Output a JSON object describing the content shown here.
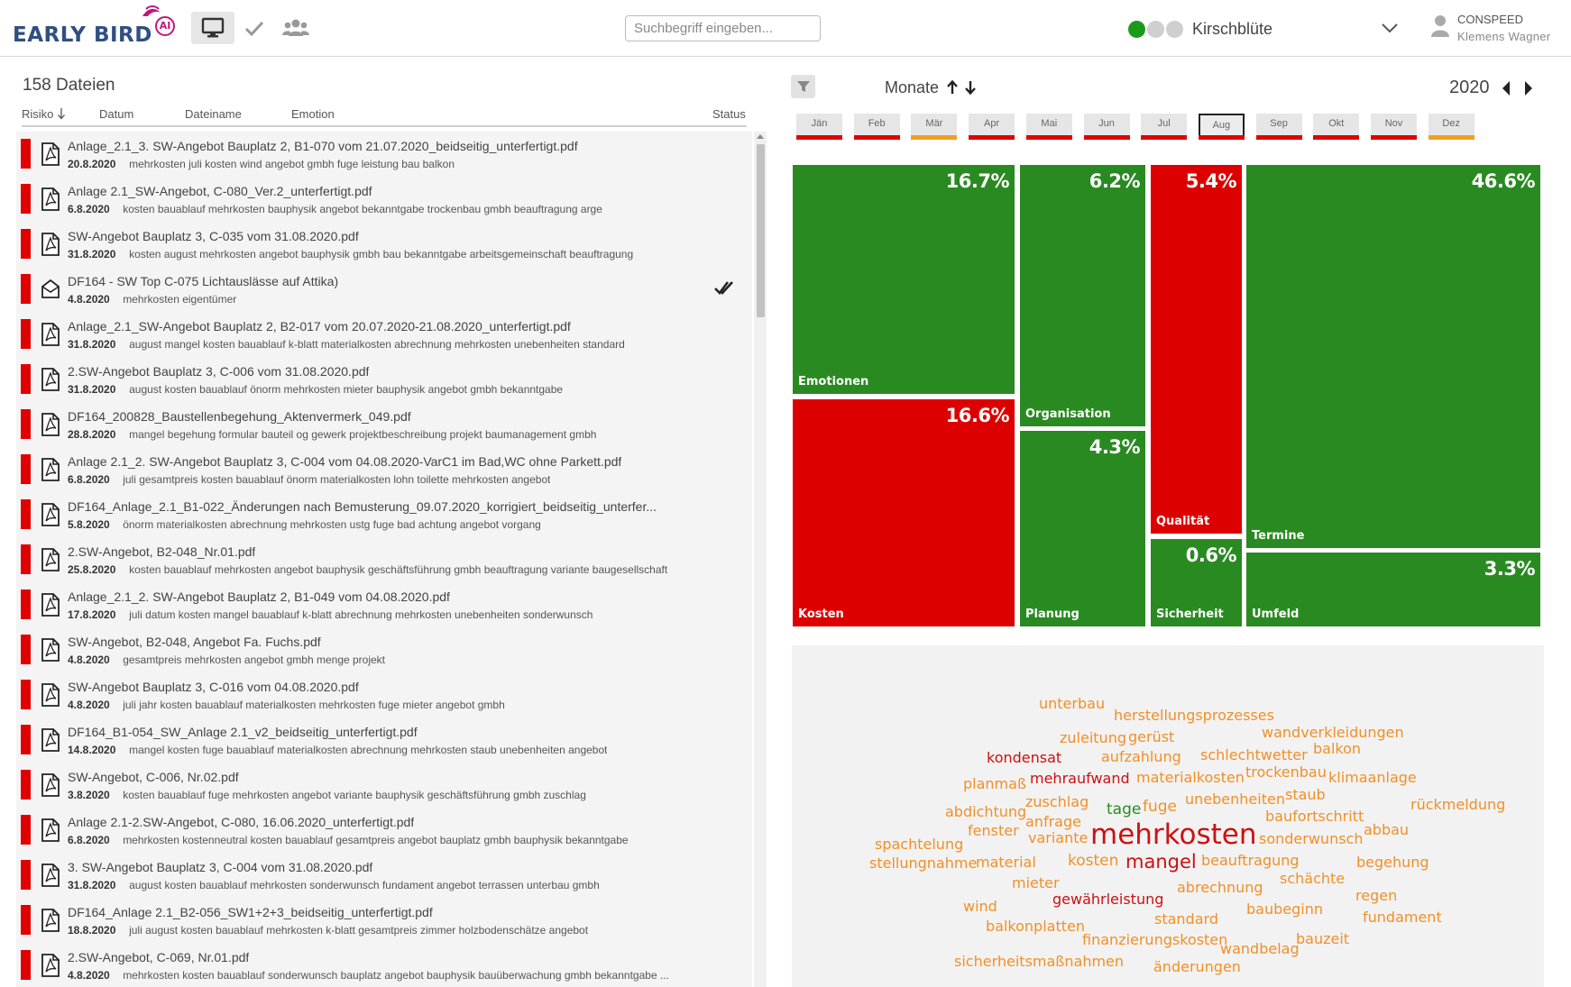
{
  "header": {
    "logo_text": "EARLY BIRD",
    "logo_badge": "AI",
    "search_placeholder": "Suchbegriff eingeben...",
    "project_name": "Kirschblüte",
    "toggle_colors": [
      "#1a9a1a",
      "#cfcfcf",
      "#cfcfcf"
    ],
    "user_company": "CONSPEED",
    "user_name": "Klemens Wagner"
  },
  "file_list": {
    "count_label": "158 Dateien",
    "columns": {
      "risk": "Risiko",
      "date": "Datum",
      "filename": "Dateiname",
      "emotion": "Emotion",
      "status": "Status"
    },
    "risk_color": "#e00000",
    "rows": [
      {
        "name": "Anlage_2.1_3. SW-Angebot Bauplatz 2, B1-070 vom 21.07.2020_beidseitig_unterfertigt.pdf",
        "date": "20.8.2020",
        "keywords": "mehrkosten juli kosten wind angebot gmbh fuge leistung bau balkon",
        "icon": "pdf-icon",
        "status": ""
      },
      {
        "name": "Anlage 2.1_SW-Angebot, C-080_Ver.2_unterfertigt.pdf",
        "date": "6.8.2020",
        "keywords": "kosten bauablauf mehrkosten bauphysik angebot bekanntgabe trockenbau gmbh beauftragung arge",
        "icon": "pdf-icon",
        "status": ""
      },
      {
        "name": "SW-Angebot Bauplatz 3, C-035 vom 31.08.2020.pdf",
        "date": "31.8.2020",
        "keywords": "kosten august mehrkosten angebot bauphysik gmbh bau bekanntgabe arbeitsgemeinschaft beauftragung",
        "icon": "pdf-icon",
        "status": ""
      },
      {
        "name": "DF164 - SW Top C-075 Lichtauslässe auf Attika)",
        "date": "4.8.2020",
        "keywords": "mehrkosten eigentümer",
        "icon": "mail-icon",
        "status": "double-check"
      },
      {
        "name": "Anlage_2.1_SW-Angebot Bauplatz 2, B2-017 vom 20.07.2020-21.08.2020_unterfertigt.pdf",
        "date": "31.8.2020",
        "keywords": "august mangel kosten bauablauf k-blatt materialkosten abrechnung mehrkosten unebenheiten standard",
        "icon": "pdf-icon",
        "status": ""
      },
      {
        "name": "2.SW-Angebot Bauplatz 3, C-006 vom 31.08.2020.pdf",
        "date": "31.8.2020",
        "keywords": "august kosten bauablauf önorm mehrkosten mieter bauphysik angebot gmbh bekanntgabe",
        "icon": "pdf-icon",
        "status": ""
      },
      {
        "name": "DF164_200828_Baustellenbegehung_Aktenvermerk_049.pdf",
        "date": "28.8.2020",
        "keywords": "mangel begehung formular bauteil og gewerk projektbeschreibung projekt baumanagement gmbh",
        "icon": "pdf-icon",
        "status": ""
      },
      {
        "name": "Anlage 2.1_2. SW-Angebot Bauplatz 3, C-004 vom 04.08.2020-VarC1 im Bad,WC ohne Parkett.pdf",
        "date": "6.8.2020",
        "keywords": "juli gesamtpreis kosten bauablauf önorm materialkosten lohn toilette mehrkosten angebot",
        "icon": "pdf-icon",
        "status": ""
      },
      {
        "name": "DF164_Anlage_2.1_B1-022_Änderungen nach Bemusterung_09.07.2020_korrigiert_beidseitig_unterfer...",
        "date": "5.8.2020",
        "keywords": "önorm materialkosten abrechnung mehrkosten ustg fuge bad achtung angebot vorgang",
        "icon": "pdf-icon",
        "status": ""
      },
      {
        "name": "2.SW-Angebot, B2-048_Nr.01.pdf",
        "date": "25.8.2020",
        "keywords": "kosten bauablauf mehrkosten angebot bauphysik geschäftsführung gmbh beauftragung variante baugesellschaft",
        "icon": "pdf-icon",
        "status": ""
      },
      {
        "name": "Anlage_2.1_2. SW-Angebot Bauplatz 2, B1-049 vom 04.08.2020.pdf",
        "date": "17.8.2020",
        "keywords": "juli datum kosten mangel bauablauf k-blatt abrechnung mehrkosten unebenheiten sonderwunsch",
        "icon": "pdf-icon",
        "status": ""
      },
      {
        "name": "SW-Angebot, B2-048, Angebot Fa. Fuchs.pdf",
        "date": "4.8.2020",
        "keywords": "gesamtpreis mehrkosten angebot gmbh menge projekt",
        "icon": "pdf-icon",
        "status": ""
      },
      {
        "name": "SW-Angebot Bauplatz 3, C-016 vom 04.08.2020.pdf",
        "date": "4.8.2020",
        "keywords": "juli jahr kosten bauablauf materialkosten mehrkosten fuge mieter angebot gmbh",
        "icon": "pdf-icon",
        "status": ""
      },
      {
        "name": "DF164_B1-054_SW_Anlage 2.1_v2_beidseitig_unterfertigt.pdf",
        "date": "14.8.2020",
        "keywords": "mangel kosten fuge bauablauf materialkosten abrechnung mehrkosten staub unebenheiten angebot",
        "icon": "pdf-icon",
        "status": ""
      },
      {
        "name": "SW-Angebot, C-006, Nr.02.pdf",
        "date": "3.8.2020",
        "keywords": "kosten bauablauf fuge mehrkosten angebot variante bauphysik geschäftsführung gmbh zuschlag",
        "icon": "pdf-icon",
        "status": ""
      },
      {
        "name": "Anlage 2.1-2.SW-Angebot, C-080, 16.06.2020_unterfertigt.pdf",
        "date": "6.8.2020",
        "keywords": "mehrkosten kostenneutral kosten bauablauf gesamtpreis angebot bauplatz gmbh bauphysik bekanntgabe",
        "icon": "pdf-icon",
        "status": ""
      },
      {
        "name": "3. SW-Angebot Bauplatz 3, C-004 vom 31.08.2020.pdf",
        "date": "31.8.2020",
        "keywords": "august kosten bauablauf mehrkosten sonderwunsch fundament angebot terrassen unterbau gmbh",
        "icon": "pdf-icon",
        "status": ""
      },
      {
        "name": "DF164_Anlage 2.1_B2-056_SW1+2+3_beidseitig_unterfertigt.pdf",
        "date": "18.8.2020",
        "keywords": "juli august kosten bauablauf mehrkosten k-blatt gesamtpreis zimmer holzbodenschätze angebot",
        "icon": "pdf-icon",
        "status": ""
      },
      {
        "name": "2.SW-Angebot, C-069, Nr.01.pdf",
        "date": "4.8.2020",
        "keywords": "mehrkosten kosten bauablauf sonderwunsch bauplatz angebot bauphysik bauüberwachung gmbh bekanntgabe ...",
        "icon": "pdf-icon",
        "status": ""
      }
    ]
  },
  "timeline": {
    "label": "Monate",
    "year": "2020",
    "selected": "Aug",
    "months": [
      {
        "label": "Jän",
        "color": "#e00000"
      },
      {
        "label": "Feb",
        "color": "#e00000"
      },
      {
        "label": "Mär",
        "color": "#f0a020"
      },
      {
        "label": "Apr",
        "color": "#e00000"
      },
      {
        "label": "Mai",
        "color": "#e00000"
      },
      {
        "label": "Jun",
        "color": "#e00000"
      },
      {
        "label": "Jul",
        "color": "#e00000"
      },
      {
        "label": "Aug",
        "color": "#e00000"
      },
      {
        "label": "Sep",
        "color": "#e00000"
      },
      {
        "label": "Okt",
        "color": "#e00000"
      },
      {
        "label": "Nov",
        "color": "#e00000"
      },
      {
        "label": "Dez",
        "color": "#f0a020"
      }
    ]
  },
  "chart_data": {
    "type": "treemap",
    "title": "",
    "colors": {
      "green": "#2a8a22",
      "red": "#dd0000"
    },
    "items": [
      {
        "label": "Emotionen",
        "value": "16.7%",
        "color": "green"
      },
      {
        "label": "Kosten",
        "value": "16.6%",
        "color": "red"
      },
      {
        "label": "Organisation",
        "value": "6.2%",
        "color": "green"
      },
      {
        "label": "Planung",
        "value": "4.3%",
        "color": "green"
      },
      {
        "label": "Qualität",
        "value": "5.4%",
        "color": "red"
      },
      {
        "label": "Sicherheit",
        "value": "0.6%",
        "color": "green"
      },
      {
        "label": "Termine",
        "value": "46.6%",
        "color": "green"
      },
      {
        "label": "Umfeld",
        "value": "3.3%",
        "color": "green"
      }
    ]
  },
  "word_cloud": {
    "colors": {
      "red": "#cc1111",
      "orange": "#f09028",
      "green": "#2a8a22"
    },
    "words": [
      {
        "text": "unterbau",
        "color": "orange"
      },
      {
        "text": "herstellungsprozesses",
        "color": "orange"
      },
      {
        "text": "zuleitung",
        "color": "orange"
      },
      {
        "text": "gerüst",
        "color": "orange"
      },
      {
        "text": "wandverkleidungen",
        "color": "orange"
      },
      {
        "text": "kondensat",
        "color": "red"
      },
      {
        "text": "aufzahlung",
        "color": "orange"
      },
      {
        "text": "schlechtwetter",
        "color": "orange"
      },
      {
        "text": "balkon",
        "color": "orange"
      },
      {
        "text": "planmaß",
        "color": "orange"
      },
      {
        "text": "mehraufwand",
        "color": "red"
      },
      {
        "text": "materialkosten",
        "color": "orange"
      },
      {
        "text": "trockenbau",
        "color": "orange"
      },
      {
        "text": "klimaanlage",
        "color": "orange"
      },
      {
        "text": "abdichtung",
        "color": "orange"
      },
      {
        "text": "zuschlag",
        "color": "orange"
      },
      {
        "text": "tage",
        "color": "green"
      },
      {
        "text": "fuge",
        "color": "orange"
      },
      {
        "text": "unebenheiten",
        "color": "orange"
      },
      {
        "text": "staub",
        "color": "orange"
      },
      {
        "text": "rückmeldung",
        "color": "orange"
      },
      {
        "text": "anfrage",
        "color": "orange"
      },
      {
        "text": "baufortschritt",
        "color": "orange"
      },
      {
        "text": "fenster",
        "color": "orange"
      },
      {
        "text": "variante",
        "color": "orange"
      },
      {
        "text": "mehrkosten",
        "color": "red"
      },
      {
        "text": "abbau",
        "color": "orange"
      },
      {
        "text": "spachtelung",
        "color": "orange"
      },
      {
        "text": "sonderwunsch",
        "color": "orange"
      },
      {
        "text": "stellungnahme",
        "color": "orange"
      },
      {
        "text": "material",
        "color": "orange"
      },
      {
        "text": "kosten",
        "color": "orange"
      },
      {
        "text": "mangel",
        "color": "red"
      },
      {
        "text": "beauftragung",
        "color": "orange"
      },
      {
        "text": "begehung",
        "color": "orange"
      },
      {
        "text": "mieter",
        "color": "orange"
      },
      {
        "text": "schächte",
        "color": "orange"
      },
      {
        "text": "abrechnung",
        "color": "orange"
      },
      {
        "text": "wind",
        "color": "orange"
      },
      {
        "text": "gewährleistung",
        "color": "red"
      },
      {
        "text": "regen",
        "color": "orange"
      },
      {
        "text": "baubeginn",
        "color": "orange"
      },
      {
        "text": "fundament",
        "color": "orange"
      },
      {
        "text": "standard",
        "color": "orange"
      },
      {
        "text": "balkonplatten",
        "color": "orange"
      },
      {
        "text": "finanzierungskosten",
        "color": "orange"
      },
      {
        "text": "bauzeit",
        "color": "orange"
      },
      {
        "text": "wandbelag",
        "color": "orange"
      },
      {
        "text": "sicherheitsmaßnahmen",
        "color": "orange"
      },
      {
        "text": "änderungen",
        "color": "orange"
      }
    ]
  }
}
